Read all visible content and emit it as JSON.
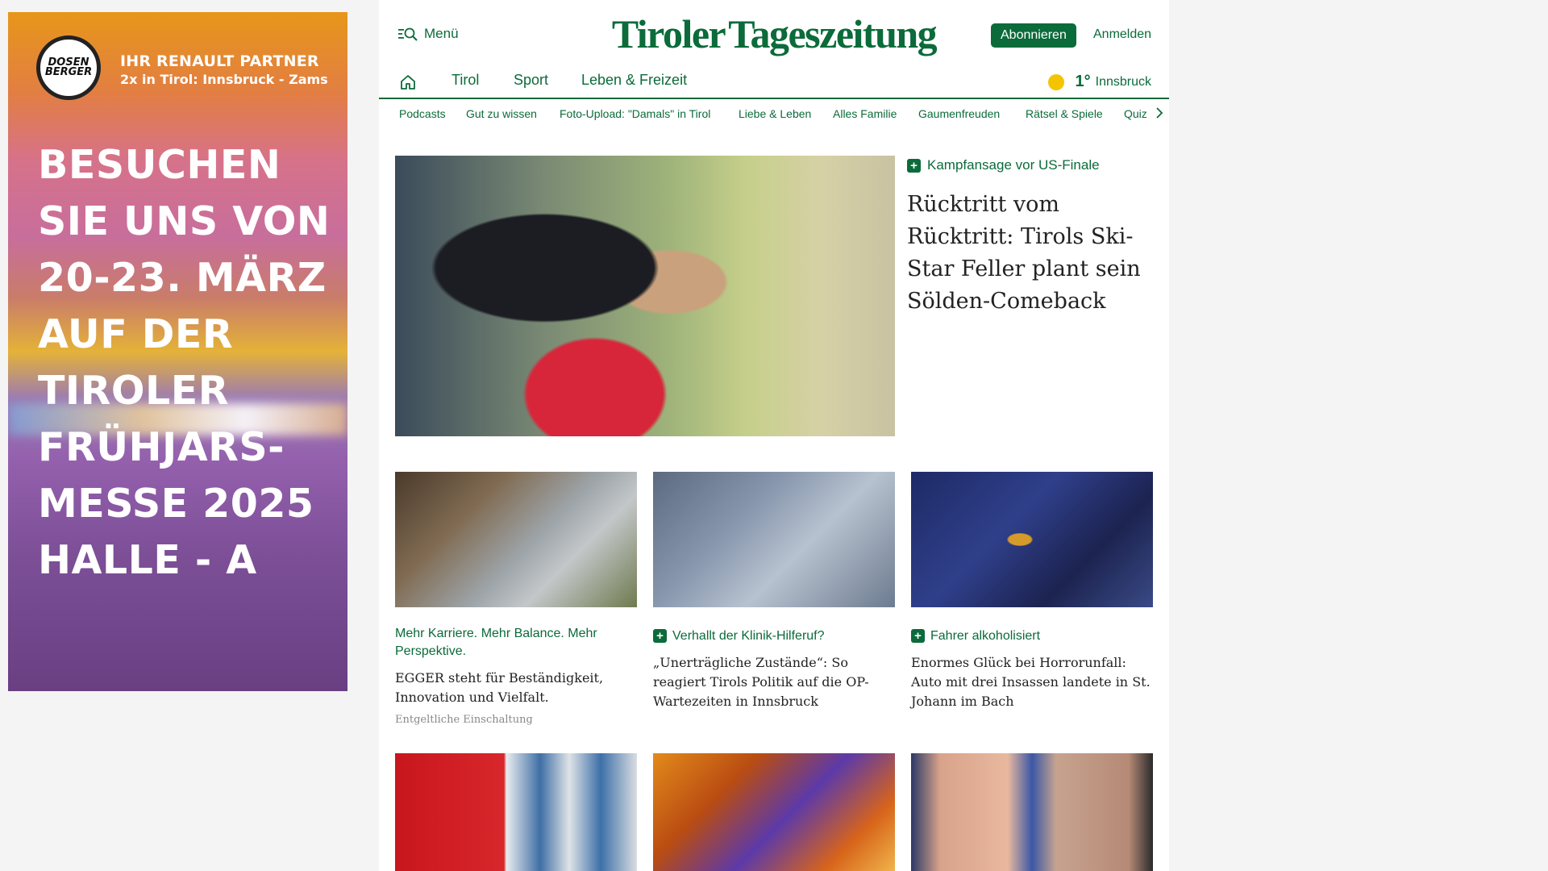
{
  "ad": {
    "logo_text": "DOSEN BERGER",
    "partner_line1": "IHR RENAULT PARTNER",
    "partner_line2": "2x in Tirol: Innsbruck - Zams",
    "headline_lines": [
      "BESUCHEN",
      "SIE UNS VON",
      "20-23. MÄRZ",
      "AUF DER",
      "TIROLER",
      "FRÜHJARS-",
      "MESSE 2025",
      "HALLE - A"
    ]
  },
  "header": {
    "menu_label": "Menü",
    "logo_left": "Tiroler",
    "logo_right": "Tageszeitung",
    "subscribe_label": "Abonnieren",
    "login_label": "Anmelden"
  },
  "nav_main": [
    "Tirol",
    "Sport",
    "Leben & Freizeit"
  ],
  "weather": {
    "temp": "1°",
    "city": "Innsbruck"
  },
  "nav_sub": [
    "Podcasts",
    "Gut zu wissen",
    "Foto-Upload: \"Damals\" in Tirol",
    "Liebe & Leben",
    "Alles Familie",
    "Gaumenfreuden",
    "Rätsel & Spiele",
    "Quiz"
  ],
  "hero": {
    "tag": "Kampfansage vor US-Finale",
    "title": "Rücktritt vom Rücktritt: Tirols Ski-Star Feller plant sein Sölden-Comeback"
  },
  "cards": [
    {
      "tag": "Mehr Karriere. Mehr Balance. Mehr Perspektive.",
      "title": "EGGER steht für Beständigkeit, Innovation und Vielfalt.",
      "sponsor": "Entgeltliche Einschaltung"
    },
    {
      "tag": "Verhallt der Klinik-Hilferuf?",
      "title": "„Unerträgliche Zustände“: So reagiert Tirols Politik auf die OP-Wartezeiten in Innsbruck"
    },
    {
      "tag": "Fahrer alkoholisiert",
      "title": "Enormes Glück bei Horrorunfall: Auto mit drei Insassen landete in St. Johann im Bach"
    }
  ],
  "colors": {
    "brand_green": "#0b6b3a",
    "sun_yellow": "#f5c400"
  }
}
